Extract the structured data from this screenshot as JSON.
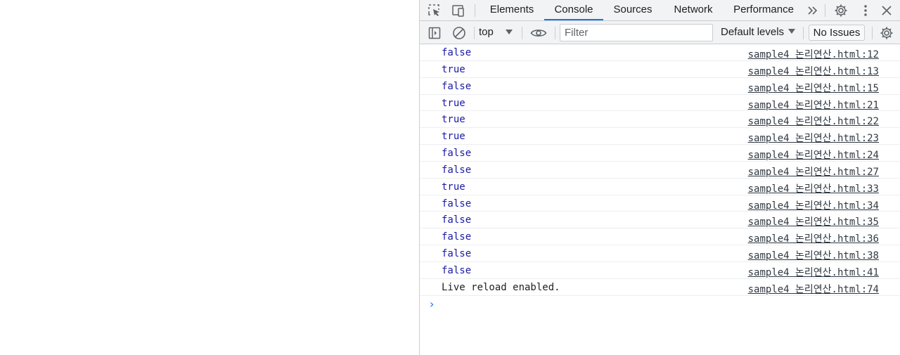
{
  "tabs": [
    {
      "label": "Elements",
      "active": false
    },
    {
      "label": "Console",
      "active": true
    },
    {
      "label": "Sources",
      "active": false
    },
    {
      "label": "Network",
      "active": false
    },
    {
      "label": "Performance",
      "active": false
    }
  ],
  "toolbar": {
    "context": "top",
    "filter_placeholder": "Filter",
    "levels": "Default levels",
    "issues": "No Issues"
  },
  "console": {
    "messages": [
      {
        "text": "false",
        "source": "sample4 논리연산.html:12"
      },
      {
        "text": "true",
        "source": "sample4 논리연산.html:13"
      },
      {
        "text": "false",
        "source": "sample4 논리연산.html:15"
      },
      {
        "text": "true",
        "source": "sample4 논리연산.html:21"
      },
      {
        "text": "true",
        "source": "sample4 논리연산.html:22"
      },
      {
        "text": "true",
        "source": "sample4 논리연산.html:23"
      },
      {
        "text": "false",
        "source": "sample4 논리연산.html:24"
      },
      {
        "text": "false",
        "source": "sample4 논리연산.html:27"
      },
      {
        "text": "true",
        "source": "sample4 논리연산.html:33"
      },
      {
        "text": "false",
        "source": "sample4 논리연산.html:34"
      },
      {
        "text": "false",
        "source": "sample4 논리연산.html:35"
      },
      {
        "text": "false",
        "source": "sample4 논리연산.html:36"
      },
      {
        "text": "false",
        "source": "sample4 논리연산.html:38"
      },
      {
        "text": "false",
        "source": "sample4 논리연산.html:41"
      },
      {
        "text": "Live reload enabled.",
        "source": "sample4 논리연산.html:74"
      }
    ],
    "prompt_symbol": "›"
  },
  "colors": {
    "accent": "#1a73e8",
    "boolean": "#1a1aa6",
    "toolbar_bg": "#f1f3f4"
  }
}
